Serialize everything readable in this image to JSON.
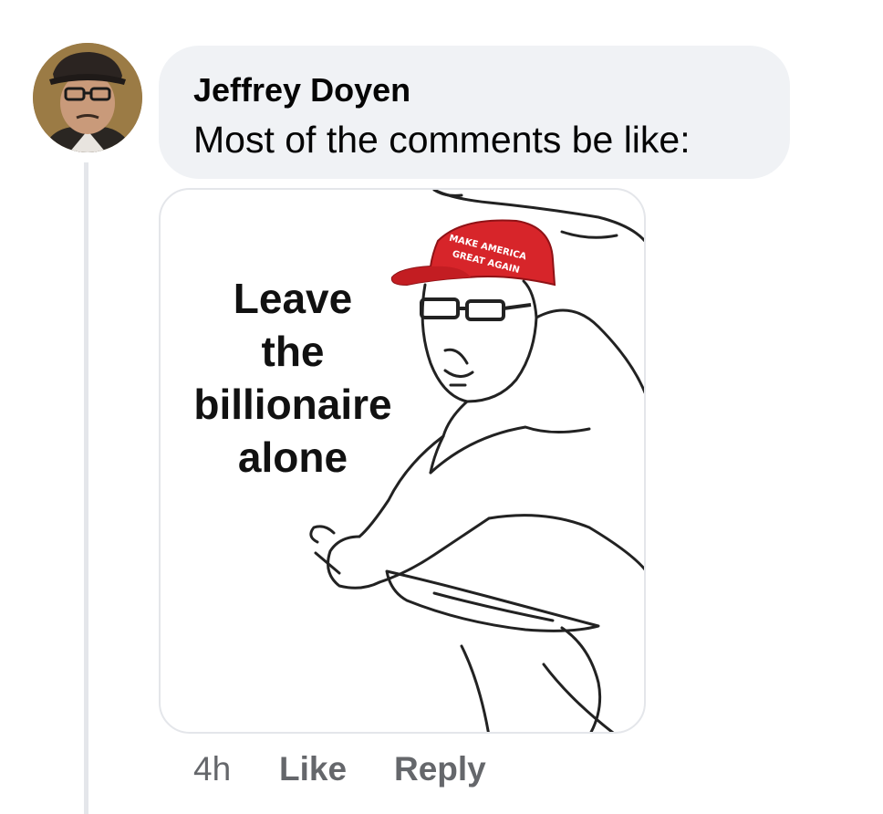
{
  "comment": {
    "author": "Jeffrey Doyen",
    "text": "Most of the comments be like:",
    "avatar_icon": "user-photo-avatar"
  },
  "attachment": {
    "caption_lines": [
      "Leave",
      "the",
      "billionaire",
      "alone"
    ],
    "hat_text": [
      "MAKE AMERICA",
      "GREAT AGAIN"
    ],
    "hat_color": "#d7252a"
  },
  "actions": {
    "timestamp": "4h",
    "like_label": "Like",
    "reply_label": "Reply"
  },
  "colors": {
    "bubble_bg": "#f0f2f5",
    "meta_text": "#65676b",
    "thread_line": "#e4e6ea"
  }
}
